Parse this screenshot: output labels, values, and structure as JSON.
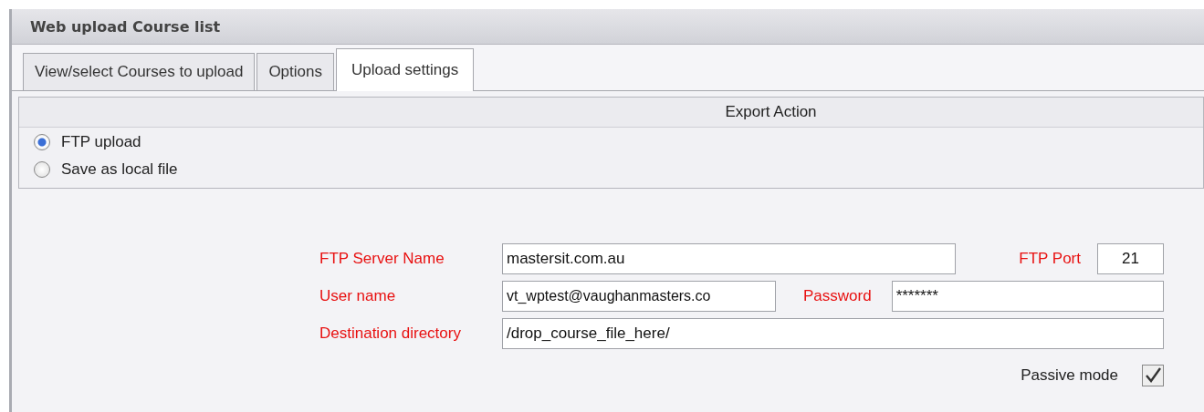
{
  "window": {
    "title": "Web upload Course list"
  },
  "tabs": [
    {
      "label": "View/select Courses to upload",
      "selected": false
    },
    {
      "label": "Options",
      "selected": false
    },
    {
      "label": "Upload settings",
      "selected": true
    }
  ],
  "export_action": {
    "title": "Export Action",
    "options": [
      {
        "label": "FTP upload",
        "selected": true
      },
      {
        "label": "Save as local file",
        "selected": false
      }
    ]
  },
  "form": {
    "server_label": "FTP Server Name",
    "server_value": "mastersit.com.au",
    "port_label": "FTP Port",
    "port_value": "21",
    "user_label": "User name",
    "user_value": "vt_wptest@vaughanmasters.co",
    "password_label": "Password",
    "password_value": "*******",
    "dir_label": "Destination directory",
    "dir_value": "/drop_course_file_here/",
    "passive_label": "Passive mode",
    "passive_checked": true
  }
}
